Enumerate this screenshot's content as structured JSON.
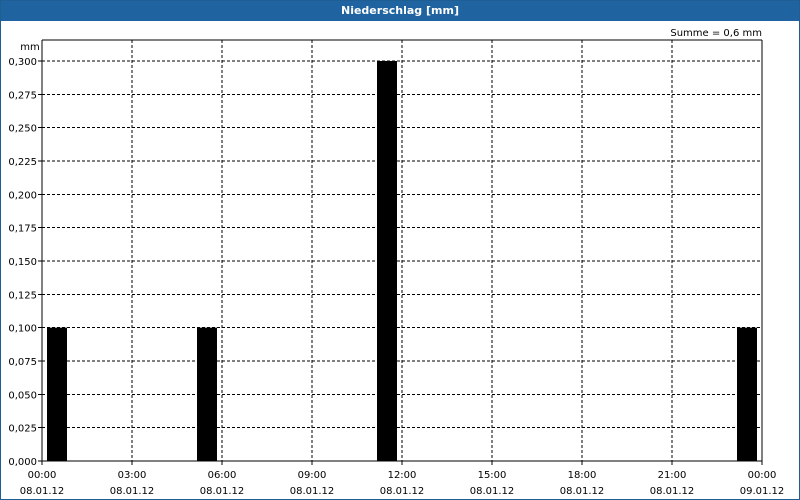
{
  "window": {
    "title": "Niederschlag [mm]"
  },
  "chart_data": {
    "type": "bar",
    "title": "Niederschlag [mm]",
    "ylabel": "mm",
    "xlabel": "",
    "annotation": "Summe = 0,6 mm",
    "ylim": [
      0,
      0.3
    ],
    "ytick_labels": [
      "0,000",
      "0,025",
      "0,050",
      "0,075",
      "0,100",
      "0,125",
      "0,150",
      "0,175",
      "0,200",
      "0,225",
      "0,250",
      "0,275",
      "0,300"
    ],
    "xtick_labels": [
      {
        "time": "00:00",
        "date": "08.01.12"
      },
      {
        "time": "03:00",
        "date": "08.01.12"
      },
      {
        "time": "06:00",
        "date": "08.01.12"
      },
      {
        "time": "09:00",
        "date": "08.01.12"
      },
      {
        "time": "12:00",
        "date": "08.01.12"
      },
      {
        "time": "15:00",
        "date": "08.01.12"
      },
      {
        "time": "18:00",
        "date": "08.01.12"
      },
      {
        "time": "21:00",
        "date": "08.01.12"
      },
      {
        "time": "00:00",
        "date": "09.01.12"
      }
    ],
    "categories": [
      "08.01.12 00:00",
      "08.01.12 05:00",
      "08.01.12 11:00",
      "08.01.12 23:00"
    ],
    "values": [
      0.1,
      0.1,
      0.3,
      0.1
    ],
    "bar_color": "#000000",
    "grid": true
  }
}
